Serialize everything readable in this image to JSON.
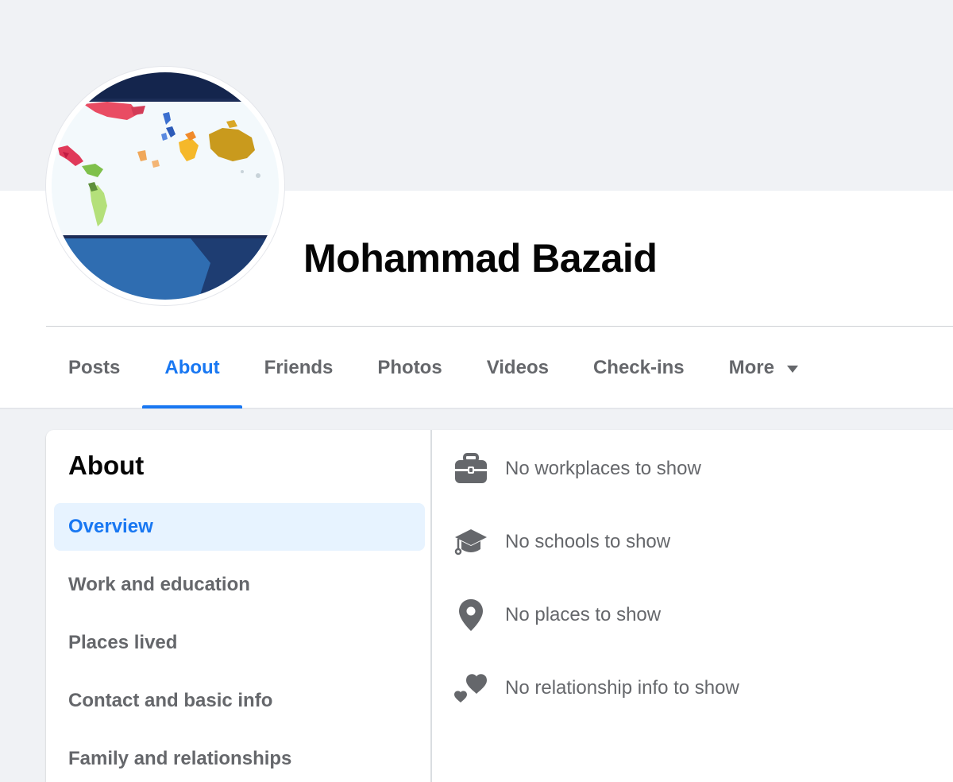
{
  "profile": {
    "name": "Mohammad Bazaid"
  },
  "tabs": [
    {
      "label": "Posts",
      "active": false
    },
    {
      "label": "About",
      "active": true
    },
    {
      "label": "Friends",
      "active": false
    },
    {
      "label": "Photos",
      "active": false
    },
    {
      "label": "Videos",
      "active": false
    },
    {
      "label": "Check-ins",
      "active": false
    },
    {
      "label": "More",
      "active": false
    }
  ],
  "about": {
    "title": "About",
    "nav": [
      {
        "label": "Overview",
        "selected": true
      },
      {
        "label": "Work and education",
        "selected": false
      },
      {
        "label": "Places lived",
        "selected": false
      },
      {
        "label": "Contact and basic info",
        "selected": false
      },
      {
        "label": "Family and relationships",
        "selected": false
      }
    ],
    "overview": [
      {
        "icon": "briefcase-icon",
        "text": "No workplaces to show"
      },
      {
        "icon": "graduation-cap-icon",
        "text": "No schools to show"
      },
      {
        "icon": "location-pin-icon",
        "text": "No places to show"
      },
      {
        "icon": "hearts-icon",
        "text": "No relationship info to show"
      }
    ]
  },
  "colors": {
    "accent": "#1877f2",
    "muted_text": "#65676b",
    "page_background": "#f0f2f5",
    "selected_nav_background": "#e7f3ff"
  }
}
